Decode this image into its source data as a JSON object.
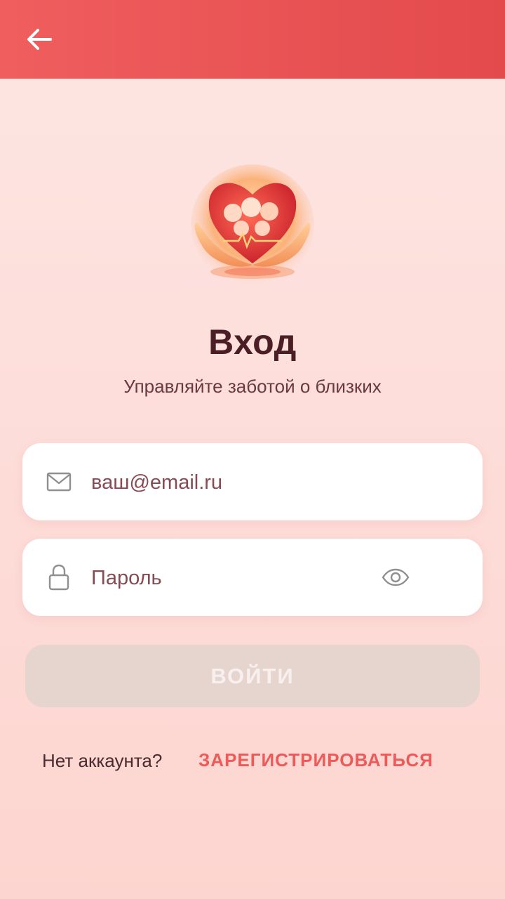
{
  "header": {
    "back_icon": "arrow-left-icon"
  },
  "logo": {
    "icon": "heart-family-hands-logo"
  },
  "title": "Вход",
  "subtitle": "Управляйте заботой о близких",
  "form": {
    "email": {
      "placeholder": "ваш@email.ru",
      "value": "",
      "icon": "mail-icon"
    },
    "password": {
      "placeholder": "Пароль",
      "value": "",
      "icon": "lock-icon",
      "toggle_icon": "eye-icon"
    },
    "submit_label": "ВОЙТИ"
  },
  "footer": {
    "prompt": "Нет аккаунта?",
    "register_label": "ЗАРЕГИСТРИРОВАТЬСЯ"
  },
  "colors": {
    "header": "#e34a4c",
    "accent": "#ee5a58",
    "title": "#4a1e24",
    "button_disabled": "#e6d4cf"
  }
}
